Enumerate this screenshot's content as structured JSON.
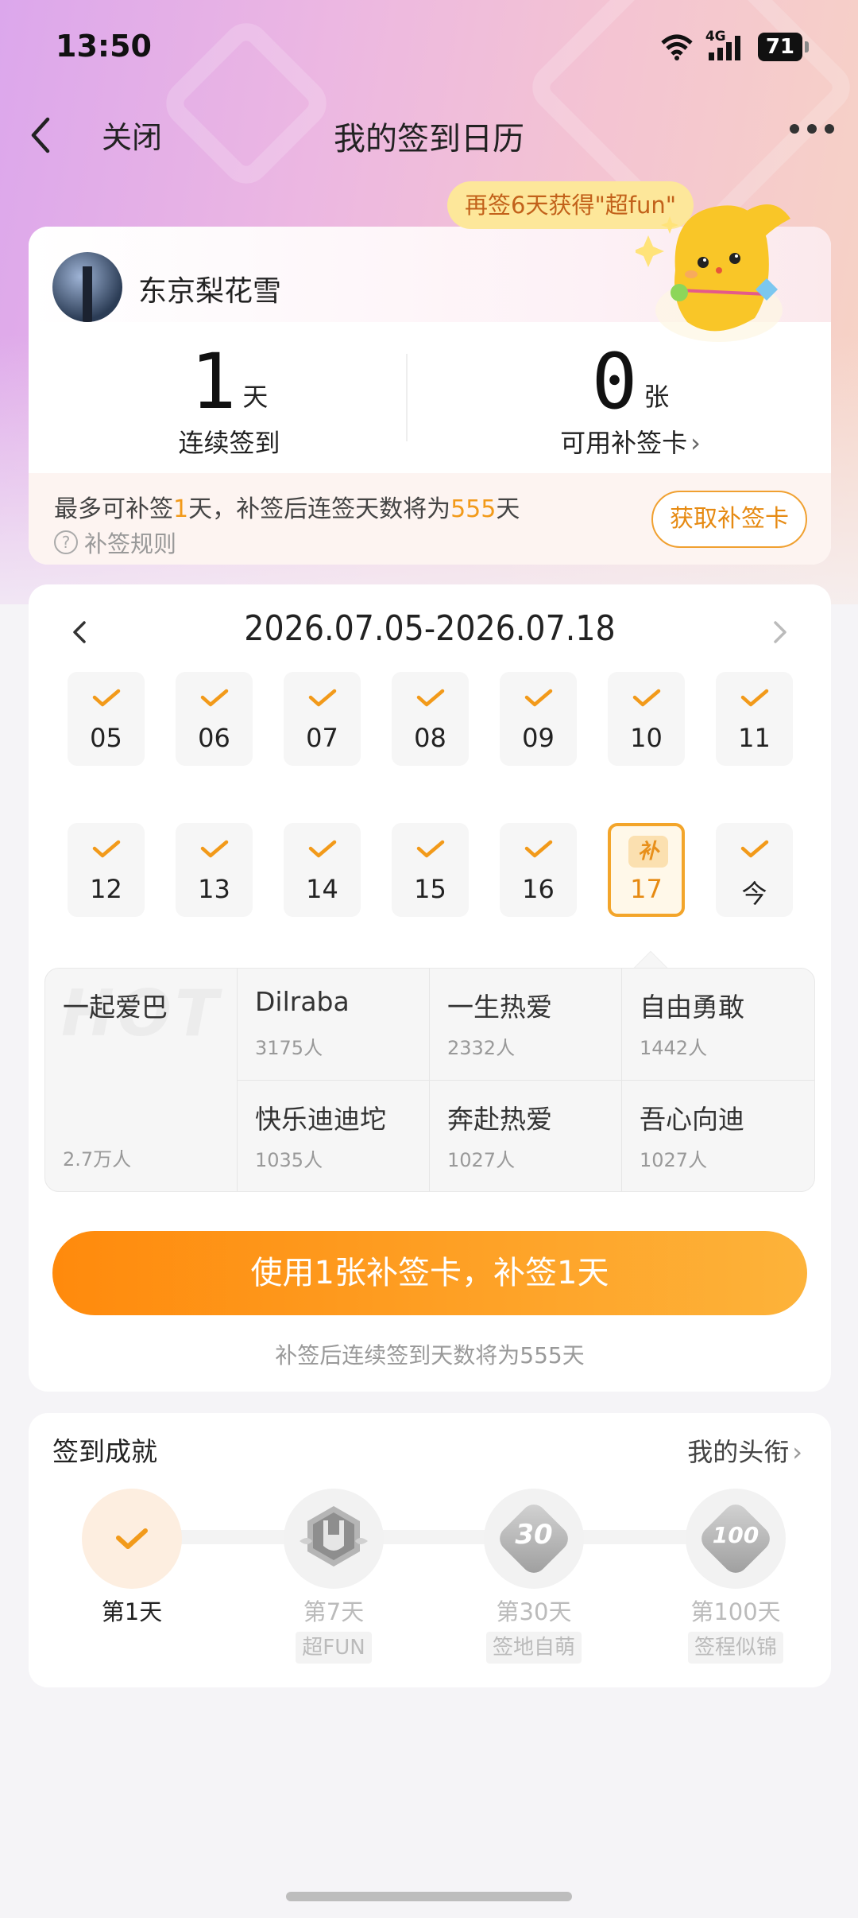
{
  "status_bar": {
    "time": "13:50",
    "network": "4G",
    "battery": "71"
  },
  "nav": {
    "close_label": "关闭",
    "title": "我的签到日历"
  },
  "promo_bubble": "再签6天获得\"超fun\"",
  "user": {
    "name": "东京梨花雪"
  },
  "stats": {
    "streak": {
      "value": "1",
      "unit": "天",
      "label": "连续签到"
    },
    "cards": {
      "value": "0",
      "unit": "张",
      "label": "可用补签卡",
      "chevron": "›"
    }
  },
  "makeup": {
    "line_prefix": "最多可补签",
    "line_days": "1",
    "line_mid": "天，补签后连签天数将为",
    "line_total": "555",
    "line_suffix": "天",
    "rule_label": "补签规则",
    "get_card_label": "获取补签卡"
  },
  "calendar": {
    "range": "2026.07.05-2026.07.18",
    "week1": [
      {
        "label": "05",
        "status": "checked"
      },
      {
        "label": "06",
        "status": "checked"
      },
      {
        "label": "07",
        "status": "checked"
      },
      {
        "label": "08",
        "status": "checked"
      },
      {
        "label": "09",
        "status": "checked"
      },
      {
        "label": "10",
        "status": "checked"
      },
      {
        "label": "11",
        "status": "checked"
      }
    ],
    "week2": [
      {
        "label": "12",
        "status": "checked"
      },
      {
        "label": "13",
        "status": "checked"
      },
      {
        "label": "14",
        "status": "checked"
      },
      {
        "label": "15",
        "status": "checked"
      },
      {
        "label": "16",
        "status": "checked"
      },
      {
        "label": "17",
        "status": "makeup",
        "badge": "补"
      },
      {
        "label": "今",
        "status": "checked"
      }
    ]
  },
  "hot_topics": {
    "watermark": "HOT",
    "featured": {
      "name": "一起爱巴",
      "count": "2.7万人"
    },
    "items": [
      {
        "name": "Dilraba",
        "count": "3175人"
      },
      {
        "name": "一生热爱",
        "count": "2332人"
      },
      {
        "name": "自由勇敢",
        "count": "1442人"
      },
      {
        "name": "快乐迪迪坨",
        "count": "1035人"
      },
      {
        "name": "奔赴热爱",
        "count": "1027人"
      },
      {
        "name": "吾心向迪",
        "count": "1027人"
      }
    ]
  },
  "use_button": "使用1张补签卡，补签1天",
  "use_hint": "补签后连续签到天数将为555天",
  "achievements": {
    "title": "签到成就",
    "link": "我的头衔",
    "link_chevron": "›",
    "items": [
      {
        "label": "第1天",
        "tag": "",
        "done": true
      },
      {
        "label": "第7天",
        "tag": "超FUN",
        "done": false
      },
      {
        "label": "第30天",
        "tag": "签地自萌",
        "done": false,
        "badge": "30"
      },
      {
        "label": "第100天",
        "tag": "签程似锦",
        "done": false,
        "badge": "100"
      }
    ]
  },
  "colors": {
    "accent": "#f29a1a",
    "button_start": "#ff8a0c",
    "button_end": "#fdb33a"
  }
}
